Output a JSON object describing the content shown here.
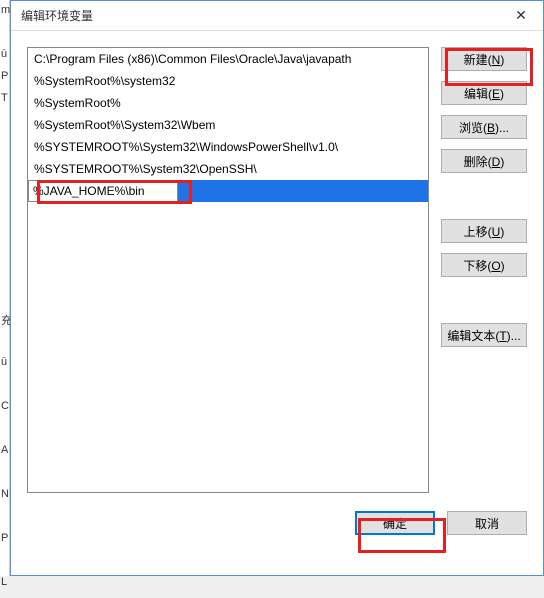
{
  "leftSnippets": [
    "m",
    "",
    "ū",
    "P",
    "T",
    "",
    "",
    "",
    "",
    "",
    "",
    "",
    "",
    "",
    "充",
    "",
    "ū",
    "",
    "C",
    "",
    "A",
    "",
    "N",
    "",
    "P",
    "",
    "L"
  ],
  "dialog": {
    "title": "编辑环境变量"
  },
  "list": {
    "items": [
      "C:\\Program Files (x86)\\Common Files\\Oracle\\Java\\javapath",
      "%SystemRoot%\\system32",
      "%SystemRoot%",
      "%SystemRoot%\\System32\\Wbem",
      "%SYSTEMROOT%\\System32\\WindowsPowerShell\\v1.0\\",
      "%SYSTEMROOT%\\System32\\OpenSSH\\"
    ],
    "editingValue": "%JAVA_HOME%\\bin"
  },
  "buttons": {
    "new_": {
      "text": "新建",
      "key": "N"
    },
    "edit": {
      "text": "编辑",
      "key": "E"
    },
    "browse": {
      "text": "浏览",
      "key": "B",
      "ellipsis": true
    },
    "delete_": {
      "text": "删除",
      "key": "D"
    },
    "moveUp": {
      "text": "上移",
      "key": "U"
    },
    "moveDown": {
      "text": "下移",
      "key": "O"
    },
    "editText": {
      "text": "编辑文本",
      "key": "T",
      "ellipsis": true
    },
    "ok": "确定",
    "cancel": "取消"
  }
}
